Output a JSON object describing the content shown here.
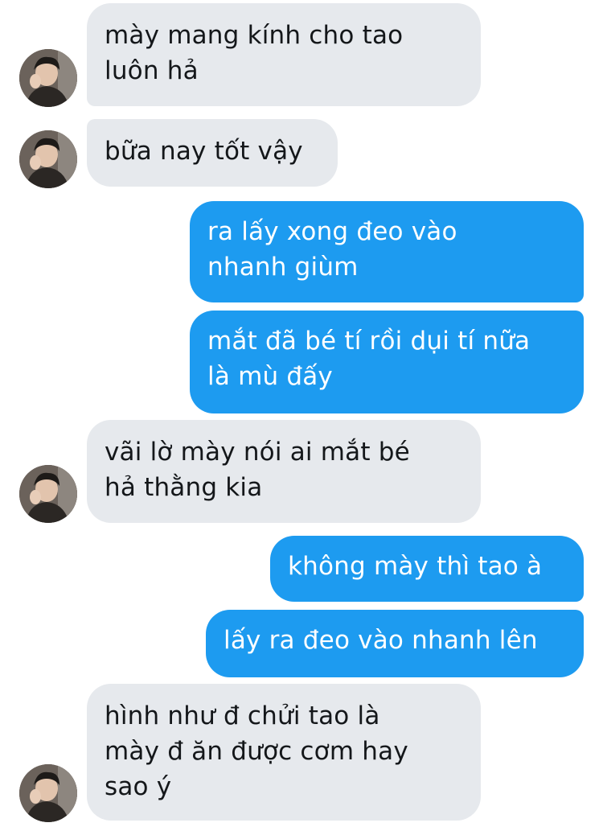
{
  "conversation": {
    "messages": [
      {
        "side": "incoming",
        "text": "mày mang kính cho tao\nluôn hả"
      },
      {
        "side": "incoming",
        "text": "bữa nay tốt vậy"
      },
      {
        "side": "outgoing",
        "text": "ra lấy xong đeo vào\nnhanh giùm"
      },
      {
        "side": "outgoing",
        "text": "mắt đã bé tí rồi dụi tí nữa\nlà mù đấy"
      },
      {
        "side": "incoming",
        "text": "vãi lờ mày nói ai mắt bé\nhả thằng kia"
      },
      {
        "side": "outgoing",
        "text": "không mày thì tao à"
      },
      {
        "side": "outgoing",
        "text": "lấy ra đeo vào nhanh lên"
      },
      {
        "side": "incoming",
        "text": "hình như đ chửi tao là\nmày đ ăn được cơm hay\nsao ý"
      }
    ]
  },
  "colors": {
    "incoming_bubble": "#e6e9ed",
    "incoming_text": "#14171a",
    "outgoing_bubble": "#1d9bf0",
    "outgoing_text": "#ffffff"
  },
  "icons": {
    "contact_avatar": "avatar-photo-icon"
  }
}
